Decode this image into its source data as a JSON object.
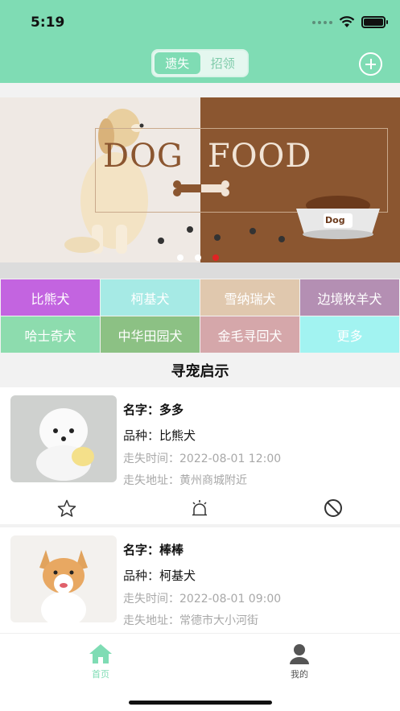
{
  "status": {
    "time": "5:19"
  },
  "segment": {
    "lost": "遗失",
    "found": "招领"
  },
  "banner": {
    "word1": "DOG",
    "word2": "FOOD",
    "bowl": "Dog"
  },
  "breeds": [
    {
      "label": "比熊犬",
      "color": "#c364e0"
    },
    {
      "label": "柯基犬",
      "color": "#a6eae5"
    },
    {
      "label": "雪纳瑞犬",
      "color": "#e0c8ae"
    },
    {
      "label": "边境牧羊犬",
      "color": "#b48fb3"
    },
    {
      "label": "哈士奇犬",
      "color": "#8ddcae"
    },
    {
      "label": "中华田园犬",
      "color": "#8cc184"
    },
    {
      "label": "金毛寻回犬",
      "color": "#d5a7aa"
    },
    {
      "label": "更多",
      "color": "#a2f3f1"
    }
  ],
  "section_title": "寻宠启示",
  "labels": {
    "name": "名字：",
    "breed": "品种：",
    "time": "走失时间：",
    "address": "走失地址："
  },
  "pets": [
    {
      "name": "多多",
      "breed": "比熊犬",
      "time": "2022-08-01 12:00",
      "address": "黄州商城附近"
    },
    {
      "name": "棒棒",
      "breed": "柯基犬",
      "time": "2022-08-01 09:00",
      "address": "常德市大小河街"
    }
  ],
  "tabs": {
    "home": "首页",
    "mine": "我的"
  },
  "colors": {
    "accent": "#7fdcb4",
    "indicator": "#e02424"
  }
}
